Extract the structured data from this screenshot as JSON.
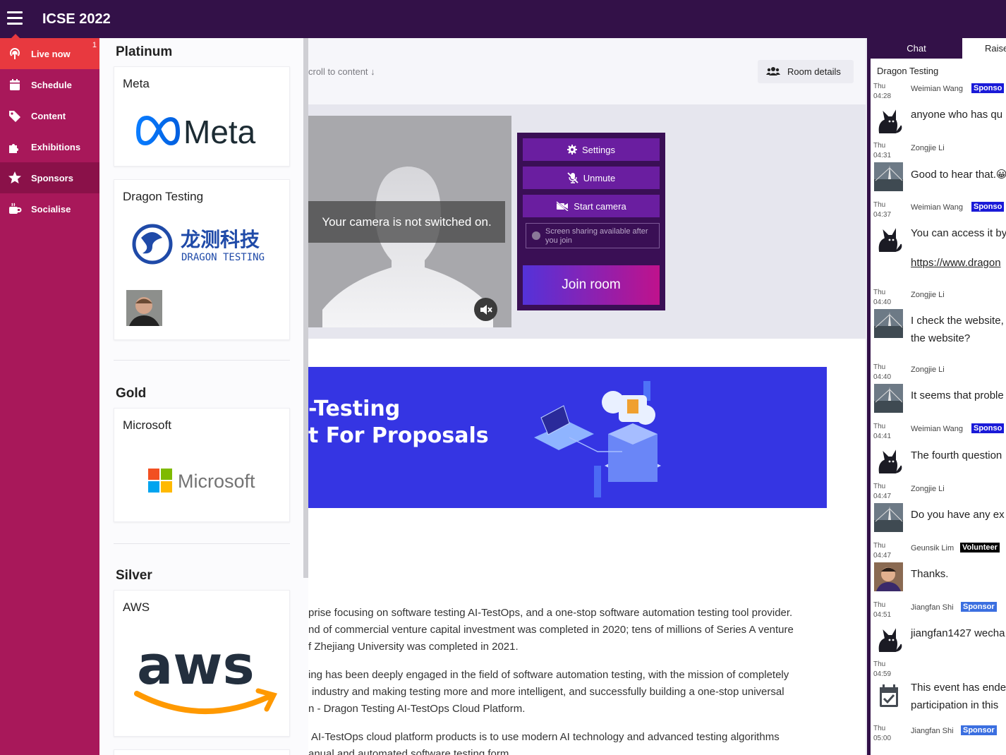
{
  "app": {
    "title": "ICSE 2022"
  },
  "nav": {
    "items": [
      {
        "label": "Live now",
        "badge": "1"
      },
      {
        "label": "Schedule"
      },
      {
        "label": "Content"
      },
      {
        "label": "Exhibitions"
      },
      {
        "label": "Sponsors"
      },
      {
        "label": "Socialise"
      }
    ]
  },
  "sponsors": {
    "tiers": [
      {
        "title": "Platinum",
        "cards": [
          {
            "name": "Meta",
            "logo_text": "Meta"
          },
          {
            "name": "Dragon Testing",
            "logo_cn": "龙测科技",
            "logo_en": "DRAGON TESTING"
          }
        ]
      },
      {
        "title": "Gold",
        "cards": [
          {
            "name": "Microsoft",
            "logo_text": "Microsoft"
          }
        ]
      },
      {
        "title": "Silver",
        "cards": [
          {
            "name": "AWS",
            "logo_text": "aws"
          }
        ]
      }
    ]
  },
  "main": {
    "scroll_link": "croll to content",
    "room_details": "Room details",
    "camera_message": "Your camera is not switched on.",
    "controls": {
      "settings": "Settings",
      "unmute": "Unmute",
      "start_camera": "Start camera",
      "screen_note": "Screen sharing available after you join",
      "join": "Join room"
    },
    "banner": {
      "line1": "-Testing",
      "line2": "t For Proposals"
    },
    "paragraphs": [
      "prise focusing on software testing AI-TestOps, and a one-stop software automation testing tool provider.",
      "nd of commercial venture capital investment was completed in 2020; tens of millions of Series A venture",
      "f Zhejiang University was completed in 2021.",
      "ing has been deeply engaged in the field of software automation testing, with the mission of completely",
      "industry and making testing more and more intelligent, and successfully building a one-stop universal",
      "n - Dragon Testing AI-TestOps Cloud Platform.",
      "AI-TestOps cloud platform products is to use modern AI technology and advanced testing algorithms",
      "anual and automated software testing form"
    ]
  },
  "chat": {
    "tabs": {
      "chat": "Chat",
      "raise": "Raise"
    },
    "room": "Dragon Testing",
    "messages": [
      {
        "day": "Thu",
        "time": "04:28",
        "author": "Weimian Wang",
        "tag": "Sponso",
        "text": "anyone who has qu"
      },
      {
        "day": "Thu",
        "time": "04:31",
        "author": "Zongjie Li",
        "text": "Good to hear that.😀"
      },
      {
        "day": "Thu",
        "time": "04:37",
        "author": "Weimian Wang",
        "tag": "Sponso",
        "text": "You can access it by",
        "link": "https://www.dragon"
      },
      {
        "day": "Thu",
        "time": "04:40",
        "author": "Zongjie Li",
        "text": "I check the website,",
        "text2": "the website?"
      },
      {
        "day": "Thu",
        "time": "04:40",
        "author": "Zongjie Li",
        "text": "It seems that proble"
      },
      {
        "day": "Thu",
        "time": "04:41",
        "author": "Weimian Wang",
        "tag": "Sponso",
        "text": "The fourth question"
      },
      {
        "day": "Thu",
        "time": "04:47",
        "author": "Zongjie Li",
        "text": "Do you have any ex"
      },
      {
        "day": "Thu",
        "time": "04:47",
        "author": "Geunsik Lim",
        "tag": "Volunteer",
        "text": "Thanks."
      },
      {
        "day": "Thu",
        "time": "04:51",
        "author": "Jiangfan Shi",
        "tag": "Sponsor",
        "text": "jiangfan1427 wecha"
      },
      {
        "day": "Thu",
        "time": "04:59",
        "text": "This event has ende",
        "text2": "participation in this"
      },
      {
        "day": "Thu",
        "time": "05:00",
        "author": "Jiangfan Shi",
        "tag": "Sponsor"
      }
    ]
  },
  "colors": {
    "topbar": "#331148",
    "nav": "#a8185a",
    "nav_active": "#e8393f",
    "controls": "#3a0f55",
    "button": "#6a1ea0"
  }
}
